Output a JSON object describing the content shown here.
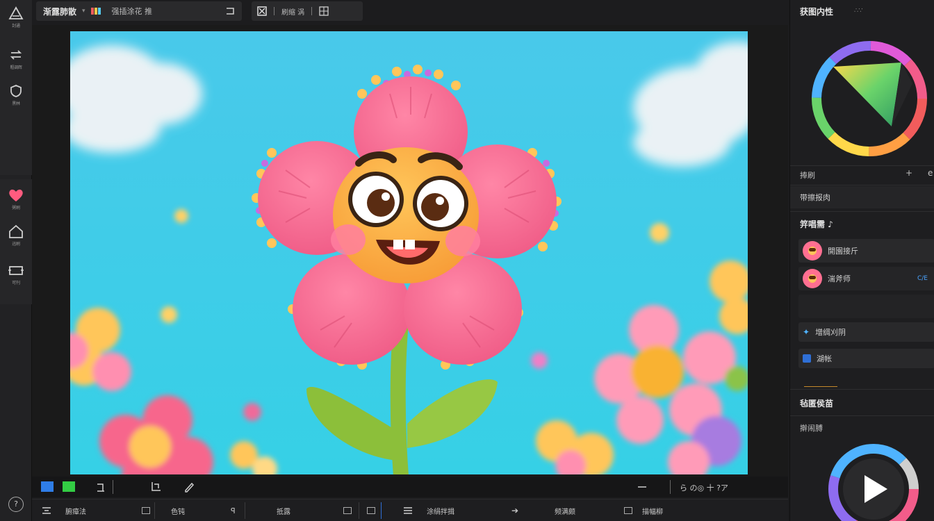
{
  "left_rail": {
    "top_items": [
      {
        "icon": "triangle-tool-icon",
        "label": "封通"
      },
      {
        "icon": "loop-tool-icon",
        "label": "粗调辉"
      },
      {
        "icon": "shield-tool-icon",
        "label": "黑林"
      }
    ],
    "bottom_items": [
      {
        "icon": "heart-icon",
        "label": "粥刷"
      },
      {
        "icon": "house-icon",
        "label": "迅刷"
      },
      {
        "icon": "frame-icon",
        "label": "可刊"
      }
    ],
    "help_label": "?"
  },
  "topbar": {
    "title": "渐露肺散",
    "file": "强插涂花 推",
    "mid_label": "刷缩 涡"
  },
  "bottom_toolbar": {
    "zoom_label": "ら の◎ 十 ?ア",
    "segments": [
      "腑瘴法",
      "色钝",
      "抵露",
      "涂绢拌揖",
      "频满颇",
      "描幅柳"
    ]
  },
  "right_panel": {
    "color_title": "获图内性",
    "color_title_extra": "∴∵",
    "brush_label": "捧刷",
    "blend_label": "带擦报肉",
    "layers_title": "笄唱需 ♪",
    "layers": [
      {
        "name": "開園接斤",
        "badge": ""
      },
      {
        "name": "湍斧师",
        "badge": "C/E"
      }
    ],
    "actions": [
      "增绸刈阴",
      "湖帐"
    ],
    "output_title": "毡匿侯苗",
    "output_sub": "擀闹膊",
    "play_label": "play"
  },
  "colors": {
    "accent_blue": "#2f7de6",
    "accent_green": "#33cc44",
    "sky": "#3fc7e8",
    "petal_pink": "#f7668c",
    "face_orange": "#ffb347"
  }
}
